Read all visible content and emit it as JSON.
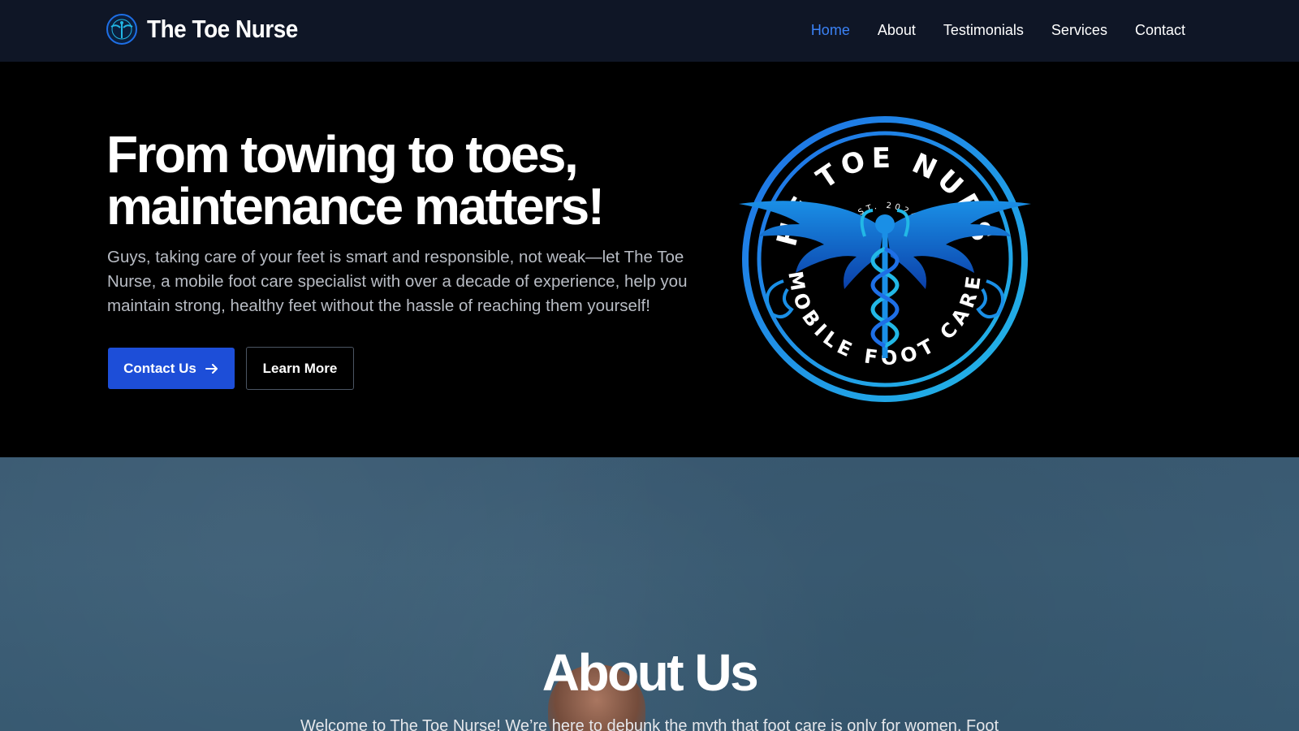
{
  "header": {
    "brand_name": "The Toe Nurse",
    "nav": [
      {
        "label": "Home",
        "active": true
      },
      {
        "label": "About",
        "active": false
      },
      {
        "label": "Testimonials",
        "active": false
      },
      {
        "label": "Services",
        "active": false
      },
      {
        "label": "Contact",
        "active": false
      }
    ]
  },
  "hero": {
    "title_line1": "From towing to toes,",
    "title_line2": "maintenance matters!",
    "description": "Guys, taking care of your feet is smart and responsible, not weak—let The Toe Nurse, a mobile foot care specialist with over a decade of experience, help you maintain strong, healthy feet without the hassle of reaching them yourself!",
    "primary_button": "Contact Us",
    "secondary_button": "Learn More",
    "logo": {
      "top_text": "THE TOE NURSE",
      "established": "EST. 2024",
      "bottom_text": "MOBILE FOOT CARE"
    }
  },
  "about": {
    "title": "About Us",
    "intro": "Welcome to The Toe Nurse! We’re here to debunk the myth that foot care is only for women. Foot"
  },
  "colors": {
    "navbar_bg": "#0f1626",
    "accent": "#1d4ed8",
    "active_nav": "#3b82f6",
    "logo_blue": "#1e6fe6",
    "logo_cyan": "#22b8e6"
  }
}
